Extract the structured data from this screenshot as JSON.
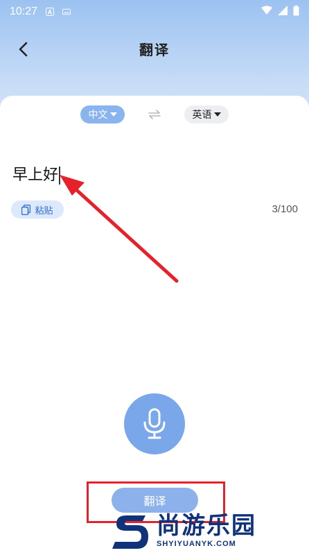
{
  "status_bar": {
    "time": "10:27"
  },
  "header": {
    "title": "翻译"
  },
  "languages": {
    "source": "中文",
    "target": "英语"
  },
  "input": {
    "text": "早上好"
  },
  "paste": {
    "label": "粘贴"
  },
  "counter": {
    "text": "3/100"
  },
  "actions": {
    "translate_label": "翻译"
  },
  "watermark": {
    "cn": "尚游乐园",
    "en": "SHYIYUANYK.COM"
  },
  "colors": {
    "accent": "#7aa6ea",
    "annotation": "#e6212b",
    "watermark": "#10327a"
  }
}
